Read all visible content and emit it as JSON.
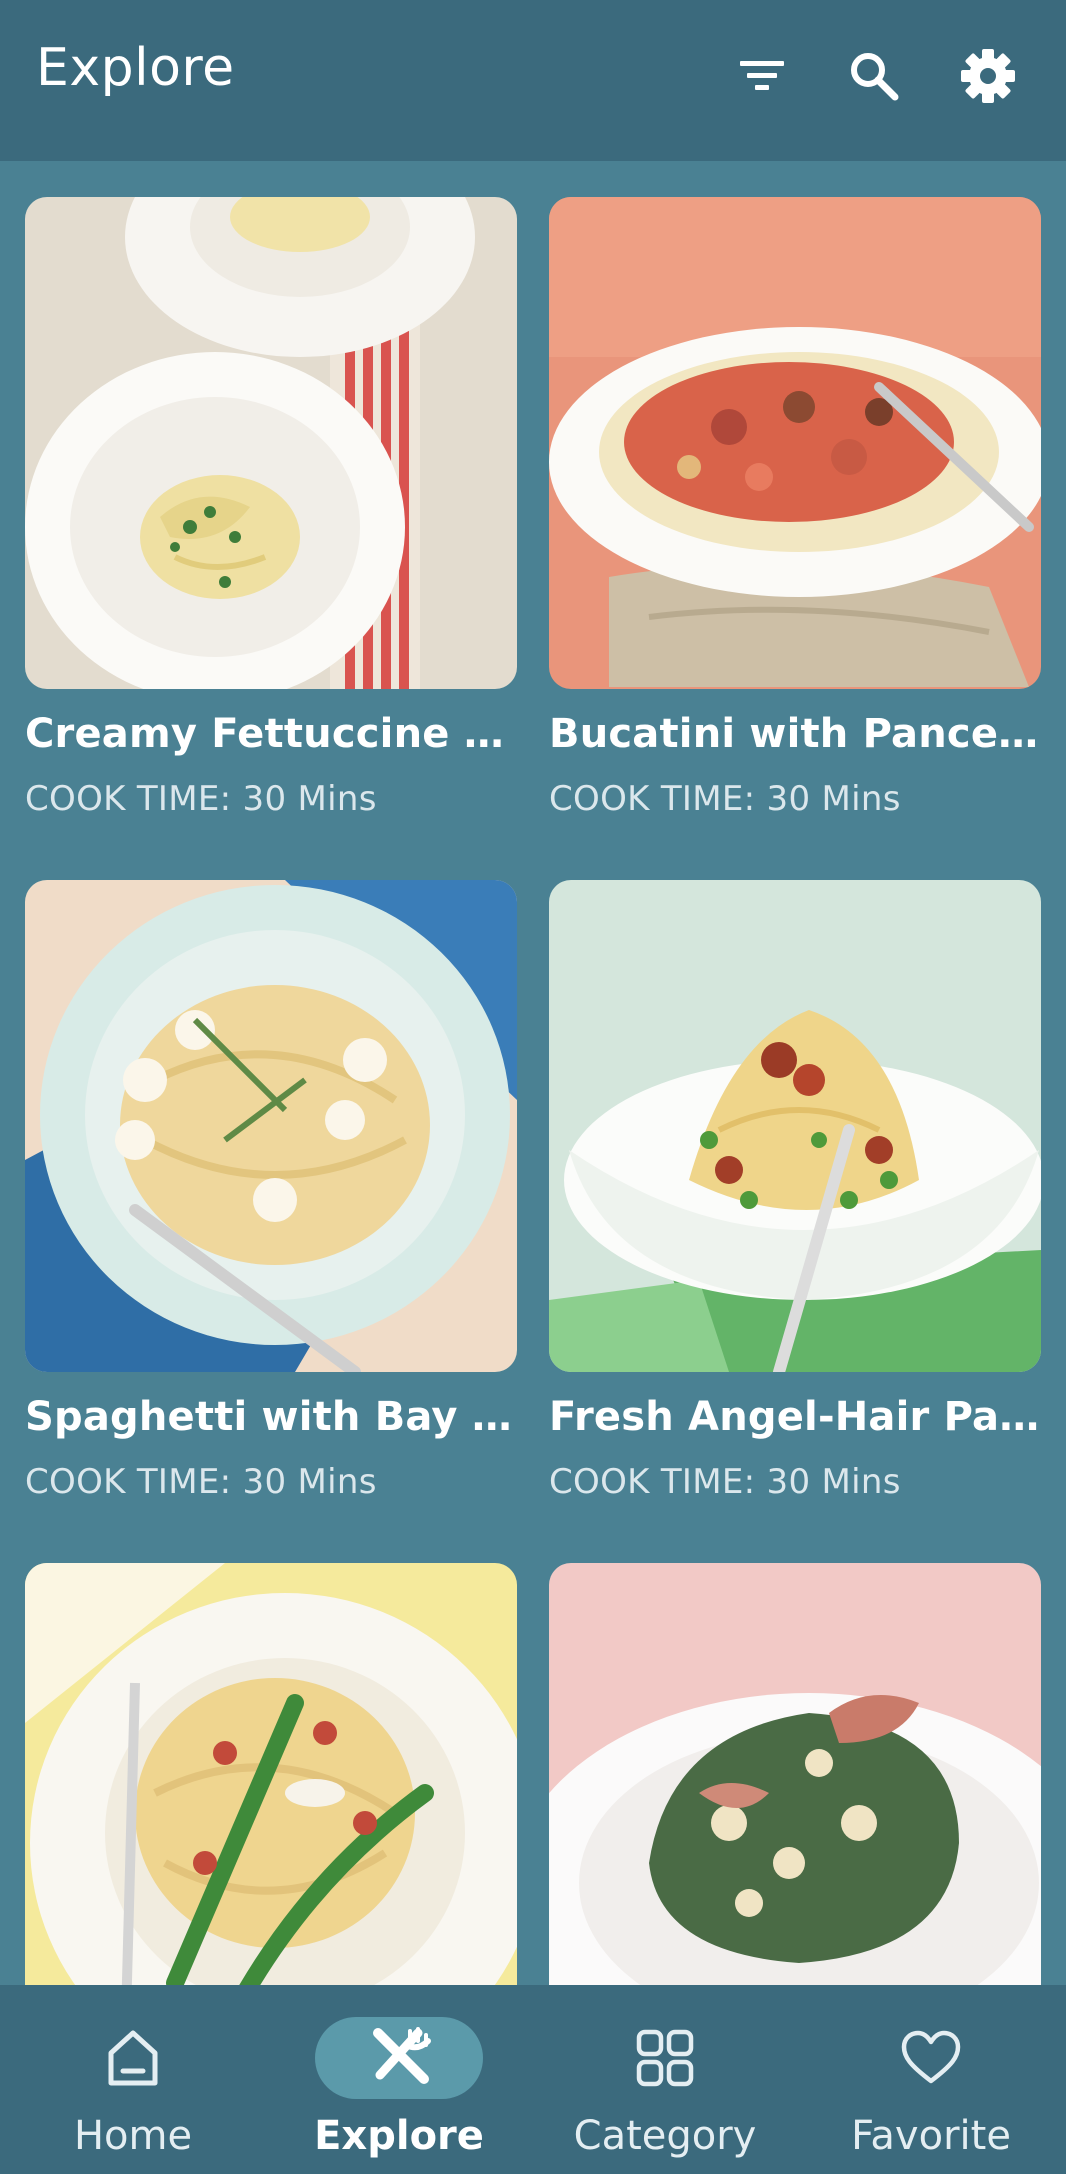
{
  "colors": {
    "appbar_bg": "#3b6a7d",
    "page_bg": "#4a8193",
    "active_pill": "#5b9aaa"
  },
  "header": {
    "title": "Explore",
    "icons": [
      "filter-icon",
      "search-icon",
      "gear-icon"
    ]
  },
  "recipes": [
    {
      "name": "Creamy Fettuccine wi...",
      "cook_time": "COOK TIME: 30 Mins"
    },
    {
      "name": "Bucatini with Pancetta...",
      "cook_time": "COOK TIME: 30 Mins"
    },
    {
      "name": "Spaghetti with Bay Sc...",
      "cook_time": "COOK TIME: 30 Mins"
    },
    {
      "name": "Fresh Angel-Hair Past...",
      "cook_time": "COOK TIME: 30 Mins"
    },
    {
      "name": "",
      "cook_time": ""
    },
    {
      "name": "",
      "cook_time": ""
    }
  ],
  "nav": {
    "items": [
      {
        "label": "Home",
        "icon": "home-icon",
        "active": false
      },
      {
        "label": "Explore",
        "icon": "fork-knife-icon",
        "active": true
      },
      {
        "label": "Category",
        "icon": "grid-icon",
        "active": false
      },
      {
        "label": "Favorite",
        "icon": "heart-icon",
        "active": false
      }
    ]
  }
}
